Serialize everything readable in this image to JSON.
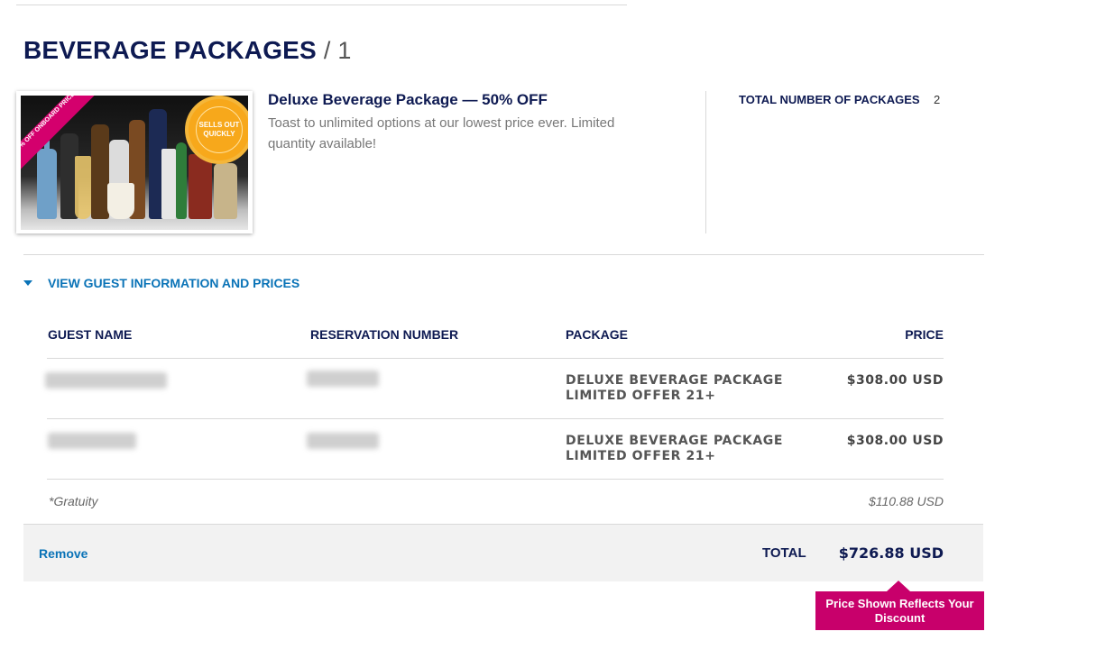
{
  "section": {
    "title": "BEVERAGE PACKAGES",
    "count": "/ 1"
  },
  "product": {
    "image_ribbon": "50% OFF ONBOARD PRICES",
    "image_seal": "SELLS OUT QUICKLY",
    "name": "Deluxe Beverage Package — 50% OFF",
    "description": "Toast to unlimited options at our lowest price ever. Limited quantity available!",
    "total_packages_label": "TOTAL NUMBER OF PACKAGES",
    "total_packages_value": "2"
  },
  "guest_info": {
    "toggle_label": "VIEW GUEST INFORMATION AND PRICES",
    "columns": [
      "GUEST NAME",
      "RESERVATION NUMBER",
      "PACKAGE",
      "PRICE"
    ],
    "rows": [
      {
        "package": "DELUXE BEVERAGE PACKAGE LIMITED OFFER 21+",
        "price": "$308.00 USD"
      },
      {
        "package": "DELUXE BEVERAGE PACKAGE LIMITED OFFER 21+",
        "price": "$308.00 USD"
      }
    ],
    "gratuity_label": "*Gratuity",
    "gratuity_value": "$110.88 USD"
  },
  "totals": {
    "remove_label": "Remove",
    "total_label": "TOTAL",
    "total_value": "$726.88 USD",
    "tooltip": "Price Shown Reflects Your Discount"
  },
  "colors": {
    "navy": "#0e1a52",
    "link_blue": "#0a73b7",
    "magenta": "#c8006b"
  }
}
